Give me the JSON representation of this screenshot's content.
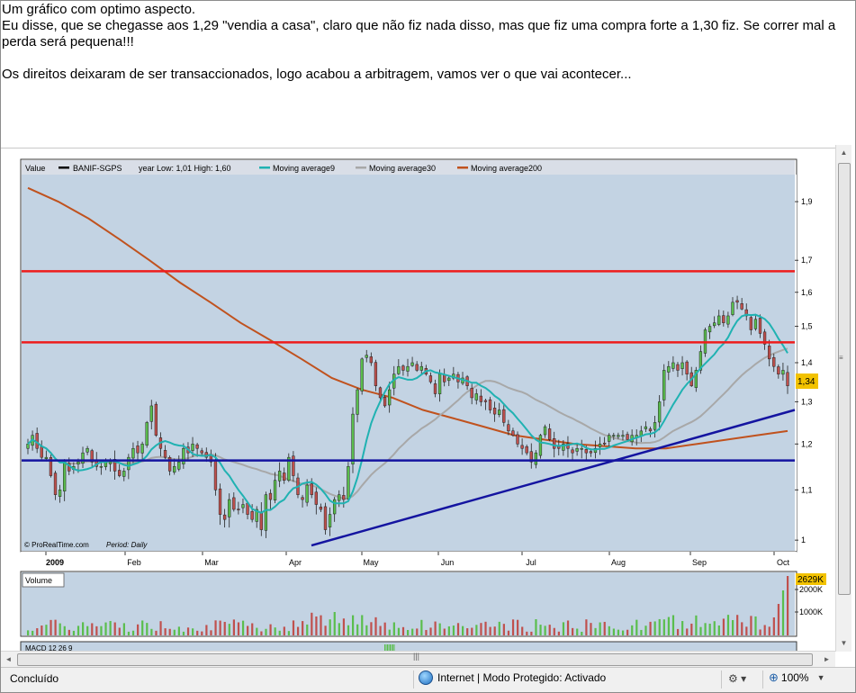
{
  "post": {
    "line1": "Um gráfico com optimo aspecto.",
    "line2": "Eu disse, que se chegasse aos 1,29 \"vendia a casa\", claro que não fiz nada disso, mas que fiz uma compra forte a 1,30 fiz. Se correr mal a perda será pequena!!!",
    "line3": "Os direitos deixaram de ser transaccionados, logo acabou a arbitragem, vamos ver o que vai acontecer..."
  },
  "legend": {
    "value_label": "Value",
    "ticker": "BANIF-SGPS",
    "range_text": "year Low: 1,01 High: 1,60",
    "ma9": "Moving average9",
    "ma30": "Moving average30",
    "ma200": "Moving average200"
  },
  "chart_footer": {
    "source": "© ProRealTime.com",
    "period": "Period: Daily"
  },
  "volume_label": "Volume",
  "macd_label": "MACD 12 26 9",
  "price_badge": "1,34",
  "volume_badge": "2629K",
  "colors": {
    "panel_bg": "#c3d3e3",
    "up_candle": "#5abe4d",
    "down_candle": "#c0504d",
    "ma9": "#20b2b2",
    "ma30": "#a8a8a8",
    "ma200": "#c0521e",
    "horizontal_lines_red": "#ee1c1c",
    "trend_lines_blue": "#1414a0",
    "badge": "#f2c200"
  },
  "chart_data": {
    "type": "candlestick",
    "x_ticks": [
      "2009",
      "Feb",
      "Mar",
      "Apr",
      "May",
      "Jun",
      "Jul",
      "Aug",
      "Sep",
      "Oct"
    ],
    "y_ticks": [
      "1",
      "1,1",
      "1,2",
      "1,3",
      "1,4",
      "1,5",
      "1,6",
      "1,7",
      "1,9"
    ],
    "ylim": [
      0.98,
      2.0
    ],
    "y_scale": "log",
    "closes": [
      1.2,
      1.22,
      1.19,
      1.17,
      1.17,
      1.13,
      1.09,
      1.1,
      1.16,
      1.14,
      1.15,
      1.16,
      1.18,
      1.19,
      1.16,
      1.15,
      1.15,
      1.16,
      1.16,
      1.14,
      1.13,
      1.14,
      1.17,
      1.19,
      1.18,
      1.2,
      1.25,
      1.29,
      1.22,
      1.19,
      1.17,
      1.14,
      1.15,
      1.16,
      1.19,
      1.18,
      1.2,
      1.19,
      1.18,
      1.17,
      1.16,
      1.1,
      1.05,
      1.04,
      1.08,
      1.06,
      1.06,
      1.07,
      1.05,
      1.04,
      1.06,
      1.02,
      1.09,
      1.08,
      1.12,
      1.14,
      1.12,
      1.17,
      1.13,
      1.09,
      1.08,
      1.11,
      1.09,
      1.07,
      1.06,
      1.02,
      1.05,
      1.08,
      1.09,
      1.08,
      1.15,
      1.27,
      1.33,
      1.41,
      1.42,
      1.4,
      1.34,
      1.31,
      1.29,
      1.33,
      1.37,
      1.39,
      1.38,
      1.39,
      1.4,
      1.38,
      1.39,
      1.37,
      1.35,
      1.32,
      1.37,
      1.35,
      1.36,
      1.37,
      1.35,
      1.36,
      1.34,
      1.31,
      1.32,
      1.3,
      1.3,
      1.28,
      1.27,
      1.28,
      1.25,
      1.23,
      1.22,
      1.2,
      1.19,
      1.18,
      1.16,
      1.18,
      1.22,
      1.24,
      1.21,
      1.19,
      1.19,
      1.2,
      1.19,
      1.18,
      1.19,
      1.19,
      1.18,
      1.18,
      1.19,
      1.2,
      1.2,
      1.22,
      1.22,
      1.22,
      1.22,
      1.21,
      1.22,
      1.22,
      1.23,
      1.24,
      1.23,
      1.25,
      1.3,
      1.38,
      1.39,
      1.4,
      1.38,
      1.4,
      1.37,
      1.34,
      1.38,
      1.43,
      1.49,
      1.5,
      1.51,
      1.53,
      1.51,
      1.53,
      1.57,
      1.57,
      1.55,
      1.53,
      1.49,
      1.52,
      1.48,
      1.45,
      1.41,
      1.39,
      1.37,
      1.38,
      1.34
    ],
    "ma200_points": [
      [
        0,
        1.95
      ],
      [
        10,
        1.9
      ],
      [
        20,
        1.84
      ],
      [
        30,
        1.77
      ],
      [
        40,
        1.7
      ],
      [
        50,
        1.63
      ],
      [
        60,
        1.57
      ],
      [
        70,
        1.51
      ],
      [
        80,
        1.46
      ],
      [
        90,
        1.41
      ],
      [
        100,
        1.36
      ],
      [
        110,
        1.33
      ],
      [
        120,
        1.31
      ],
      [
        130,
        1.28
      ],
      [
        140,
        1.26
      ],
      [
        150,
        1.24
      ],
      [
        160,
        1.22
      ],
      [
        170,
        1.21
      ],
      [
        180,
        1.2
      ],
      [
        190,
        1.195
      ],
      [
        200,
        1.19
      ],
      [
        210,
        1.19
      ],
      [
        220,
        1.2
      ],
      [
        230,
        1.21
      ],
      [
        240,
        1.22
      ],
      [
        250,
        1.23
      ]
    ],
    "red_lines": [
      1.455,
      1.665
    ],
    "blue_horizontal": 1.163,
    "trendline": [
      [
        0.99,
        "Apr"
      ],
      [
        1.28,
        "Oct+"
      ]
    ],
    "volume_ticks": [
      "1000K",
      "2000K"
    ]
  }
}
